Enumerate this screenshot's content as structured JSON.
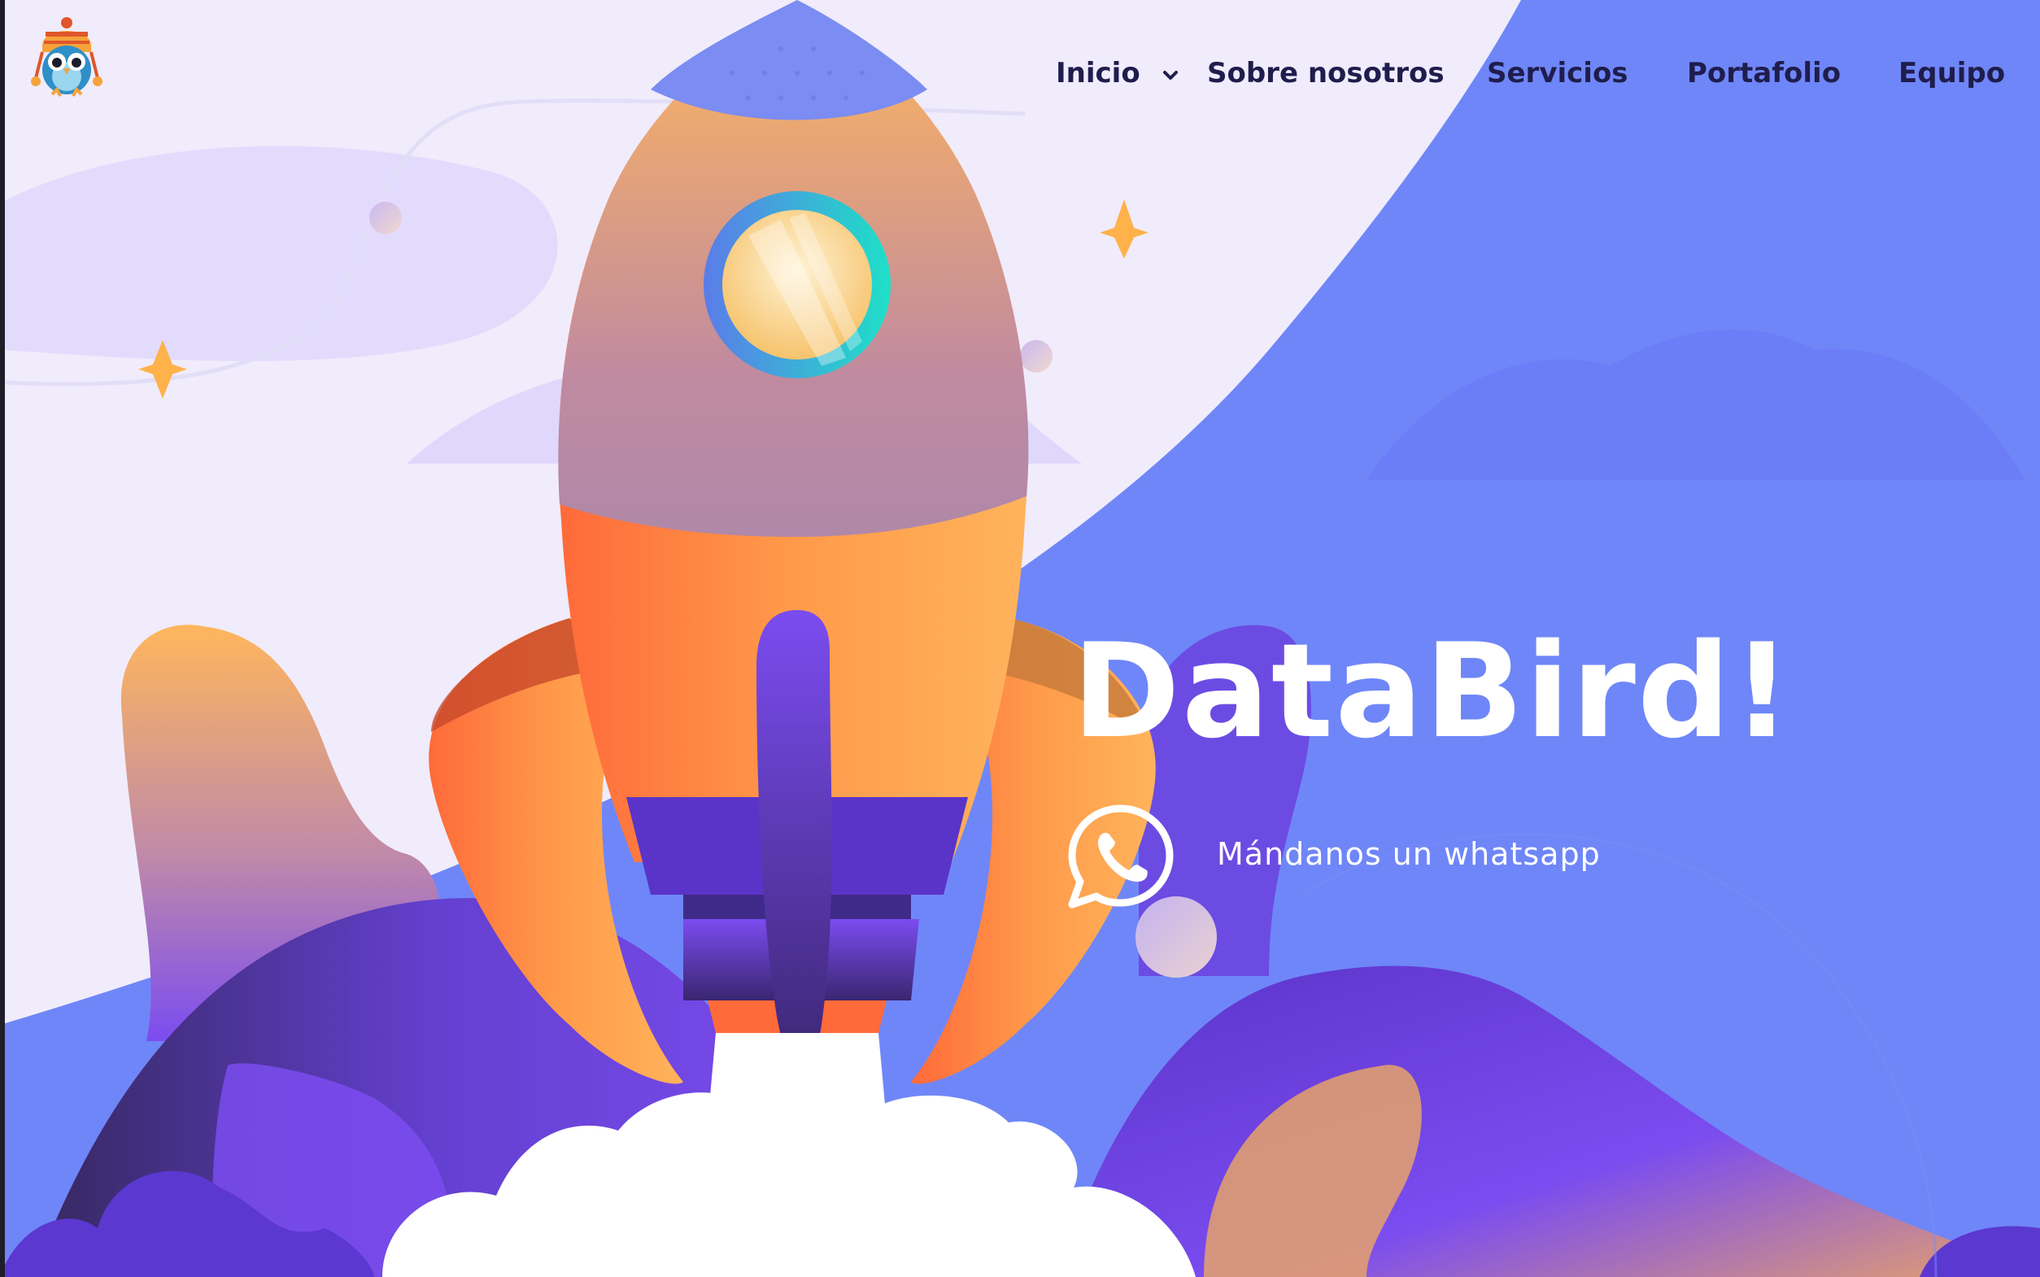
{
  "brand": {
    "logo_icon": "owl-mascot-icon"
  },
  "nav": {
    "items": [
      {
        "label": "Inicio",
        "has_dropdown": true,
        "icon": "chevron-down-icon"
      },
      {
        "label": "Sobre nosotros"
      },
      {
        "label": "Servicios"
      },
      {
        "label": "Portafolio"
      },
      {
        "label": "Equipo"
      }
    ]
  },
  "hero": {
    "title": "DataBird!",
    "cta": {
      "label": "Mándanos un whatsapp",
      "icon": "whatsapp-icon"
    }
  },
  "colors": {
    "background_light": "#f0ecfb",
    "background_blue": "#6f86f8",
    "rocket_orange": "#ff8a3d",
    "rocket_purple": "#6b3fd6",
    "nav_text": "#1f1d4d",
    "hero_text": "#ffffff"
  }
}
